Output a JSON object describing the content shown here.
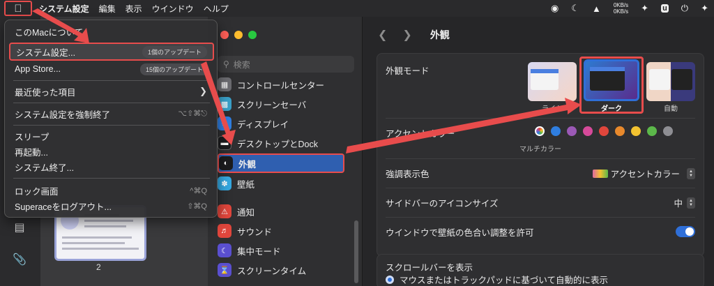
{
  "menubar": {
    "apple_icon": "apple-logo-icon",
    "items": [
      "システム設定",
      "編集",
      "表示",
      "ウインドウ",
      "ヘルプ"
    ],
    "network": {
      "up": "0KB/s",
      "down": "0KB/s"
    }
  },
  "apple_menu": {
    "about": "このMacについて",
    "system_settings": "システム設定...",
    "system_settings_badge": "1個のアップデート",
    "app_store": "App Store...",
    "app_store_badge": "15個のアップデート",
    "recent_items": "最近使った項目",
    "force_quit": "システム設定を強制終了",
    "force_quit_shortcut": "⌥⇧⌘⎋",
    "sleep": "スリープ",
    "restart": "再起動...",
    "shutdown": "システム終了...",
    "lock_screen": "ロック画面",
    "lock_shortcut": "^⌘Q",
    "logout": "Superaceをログアウト...",
    "logout_shortcut": "⇧⌘Q"
  },
  "document": {
    "page_number": "2"
  },
  "sidebar": {
    "search_placeholder": "検索",
    "items": [
      {
        "label": "コントロールセンター",
        "color": "#6b6b70"
      },
      {
        "label": "スクリーンセーバ",
        "color": "#3aa0c8"
      },
      {
        "label": "ディスプレイ",
        "color": "#2f7ee0"
      },
      {
        "label": "デスクトップとDock",
        "color": "#1c1c1e"
      },
      {
        "label": "外観",
        "color": "#1c1c1e"
      },
      {
        "label": "壁紙",
        "color": "#35a8e0"
      },
      {
        "label": "通知",
        "color": "#e0463c"
      },
      {
        "label": "サウンド",
        "color": "#e0463c"
      },
      {
        "label": "集中モード",
        "color": "#5a4fd0"
      },
      {
        "label": "スクリーンタイム",
        "color": "#5a4fd0"
      }
    ]
  },
  "content": {
    "title": "外観",
    "appearance_mode_label": "外観モード",
    "modes": [
      "ライト",
      "ダーク",
      "自動"
    ],
    "accent_label": "アクセントカラー",
    "accent_colors": [
      "#8e8e93",
      "#2f7ee0",
      "#9b59b6",
      "#d64a9a",
      "#e0463c",
      "#e8892c",
      "#f2c230",
      "#5cb84a",
      "#8e8e93"
    ],
    "accent_selected_name": "マルチカラー",
    "highlight_label": "強調表示色",
    "highlight_value": "アクセントカラー",
    "sidebar_icon_label": "サイドバーのアイコンサイズ",
    "sidebar_icon_value": "中",
    "tint_label": "ウインドウで壁紙の色合い調整を許可",
    "scroll_section_label": "スクロールバーを表示",
    "scroll_option": "マウスまたはトラックパッドに基づいて自動的に表示"
  }
}
